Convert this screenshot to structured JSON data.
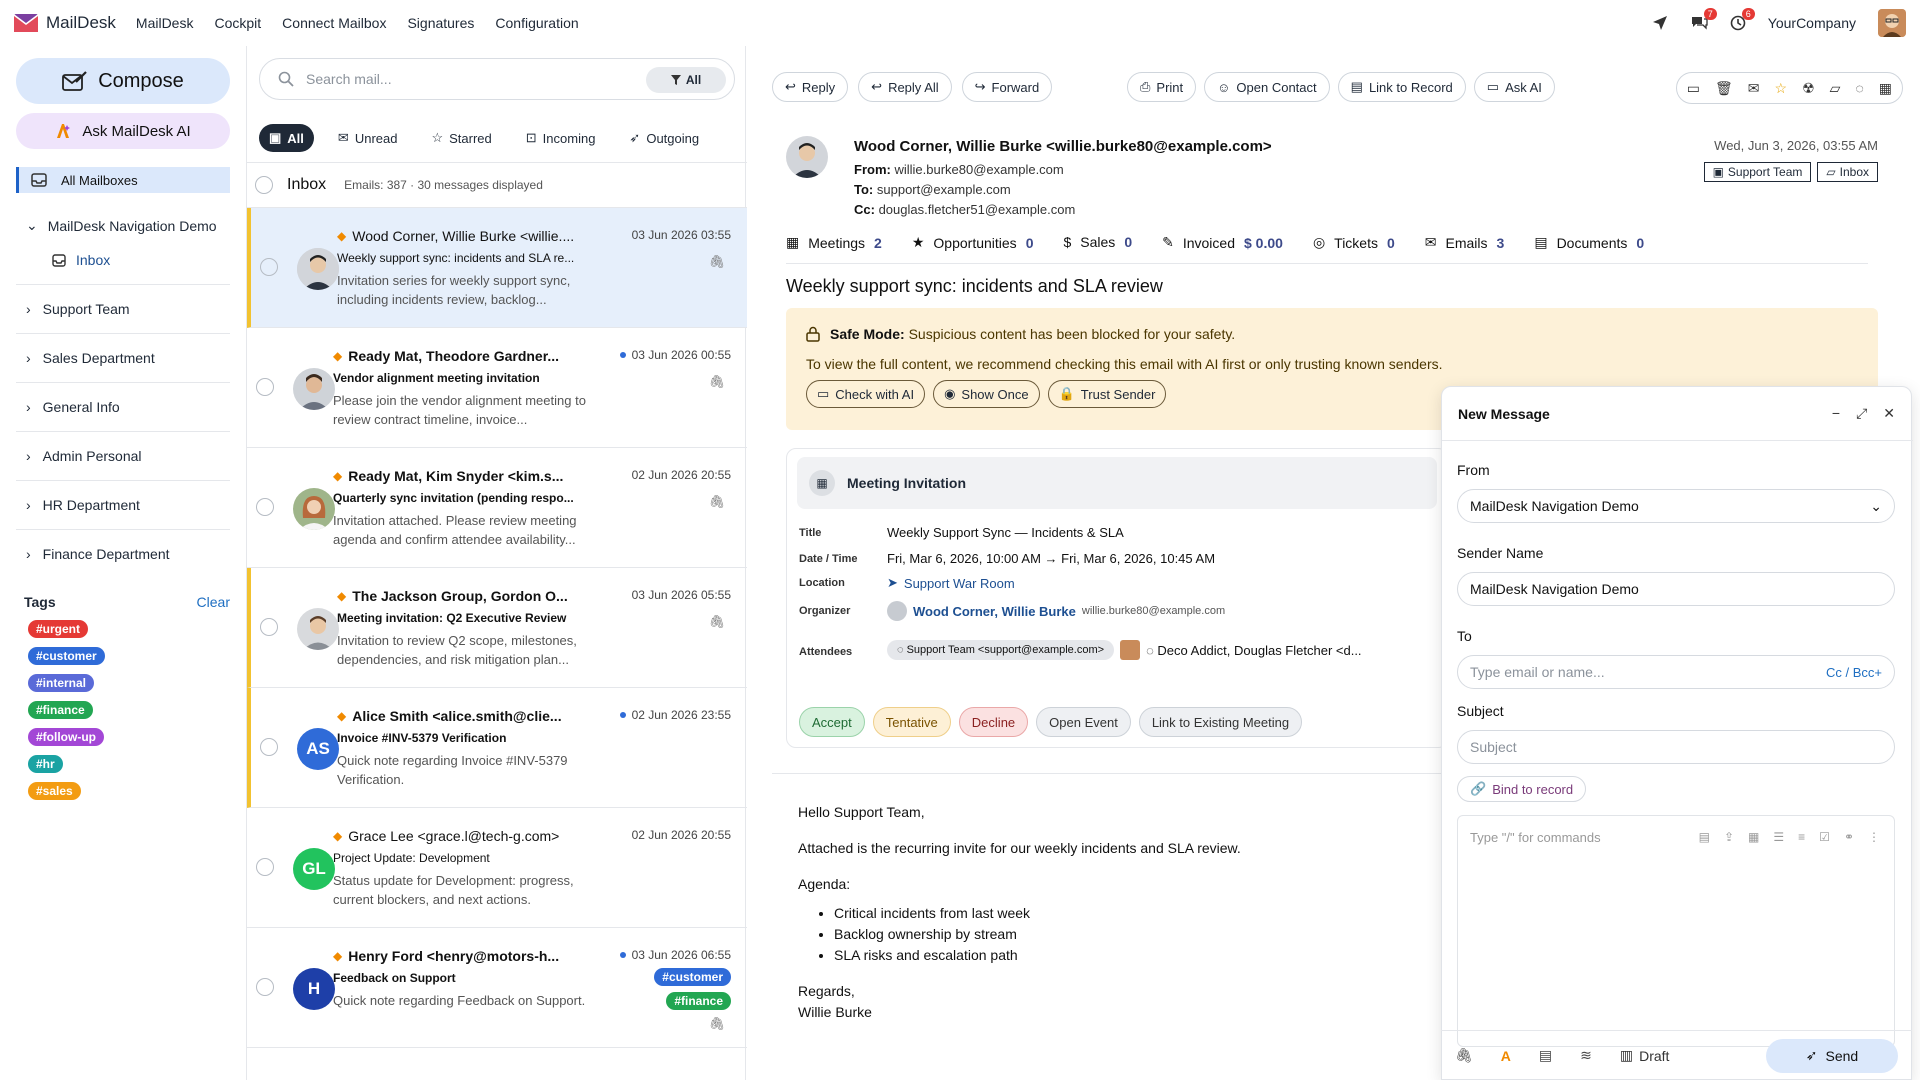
{
  "app": {
    "name": "MailDesk"
  },
  "topnav": [
    "MailDesk",
    "Cockpit",
    "Connect Mailbox",
    "Signatures",
    "Configuration"
  ],
  "topright": {
    "chat_badge": "7",
    "activity_badge": "6",
    "company": "YourCompany"
  },
  "sidebar": {
    "compose": "Compose",
    "ask_ai": "Ask MailDesk AI",
    "all_mailboxes": "All Mailboxes",
    "tree_head": "MailDesk Navigation Demo",
    "tree_inbox": "Inbox",
    "groups": [
      "Support Team",
      "Sales Department",
      "General Info",
      "Admin Personal",
      "HR Department",
      "Finance Department"
    ],
    "tags_title": "Tags",
    "tags_clear": "Clear",
    "tags": [
      {
        "label": "#urgent",
        "color": "#e53935"
      },
      {
        "label": "#customer",
        "color": "#2f6bd8"
      },
      {
        "label": "#internal",
        "color": "#5a6ad8"
      },
      {
        "label": "#finance",
        "color": "#22a652"
      },
      {
        "label": "#follow-up",
        "color": "#a347d6"
      },
      {
        "label": "#hr",
        "color": "#1aa3a3"
      },
      {
        "label": "#sales",
        "color": "#f39c12"
      }
    ]
  },
  "list": {
    "search_placeholder": "Search mail...",
    "search_filter": "All",
    "filters": [
      "All",
      "Unread",
      "Starred",
      "Incoming",
      "Outgoing"
    ],
    "folder": "Inbox",
    "count_text": "Emails: 387 · 30 messages displayed",
    "items": [
      {
        "sender": "Wood Corner, Willie Burke <willie....",
        "date": "03 Jun 2026 03:55",
        "subject": "Weekly support sync: incidents and SLA re...",
        "preview": "Invitation series for weekly support sync, including incidents review, backlog..."
      },
      {
        "sender": "Ready Mat, Theodore Gardner...",
        "date": "03 Jun 2026 00:55",
        "subject": "Vendor alignment meeting invitation",
        "preview": "Please join the vendor alignment meeting to review contract timeline, invoice..."
      },
      {
        "sender": "Ready Mat, Kim Snyder <kim.s...",
        "date": "02 Jun 2026 20:55",
        "subject": "Quarterly sync invitation (pending respo...",
        "preview": "Invitation attached. Please review meeting agenda and confirm attendee availability..."
      },
      {
        "sender": "The Jackson Group, Gordon O...",
        "date": "03 Jun 2026 05:55",
        "subject": "Meeting invitation: Q2 Executive Review",
        "preview": "Invitation to review Q2 scope, milestones, dependencies, and risk mitigation plan..."
      },
      {
        "sender": "Alice Smith <alice.smith@clie...",
        "date": "02 Jun 2026 23:55",
        "subject": "Invoice #INV-5379 Verification",
        "preview": "Quick note regarding Invoice #INV-5379 Verification.",
        "initials": "AS"
      },
      {
        "sender": "Grace Lee <grace.l@tech-g.com>",
        "date": "02 Jun 2026 20:55",
        "subject": "Project Update: Development",
        "preview": "Status update for Development: progress, current blockers, and next actions.",
        "initials": "GL"
      },
      {
        "sender": "Henry Ford <henry@motors-h...",
        "date": "03 Jun 2026 06:55",
        "subject": "Feedback on Support",
        "preview": "Quick note regarding Feedback on Support.",
        "initials": "H",
        "tag1": "#customer",
        "tag2": "#finance"
      }
    ]
  },
  "read": {
    "toolbar": [
      "Reply",
      "Reply All",
      "Forward"
    ],
    "toolbar2": [
      "Print",
      "Open Contact",
      "Link to Record",
      "Ask AI"
    ],
    "from_display": "Wood Corner, Willie Burke <willie.burke80@example.com>",
    "from_label": "From:",
    "from": "willie.burke80@example.com",
    "to_label": "To:",
    "to": "support@example.com",
    "cc_label": "Cc:",
    "cc": "douglas.fletcher51@example.com",
    "date": "Wed, Jun 3, 2026, 03:55 AM",
    "chip1": "Support Team",
    "chip2": "Inbox",
    "stats": [
      {
        "label": "Meetings",
        "value": "2"
      },
      {
        "label": "Opportunities",
        "value": "0"
      },
      {
        "label": "Sales",
        "value": "0"
      },
      {
        "label": "Invoiced",
        "value": "$ 0.00"
      },
      {
        "label": "Tickets",
        "value": "0"
      },
      {
        "label": "Emails",
        "value": "3"
      },
      {
        "label": "Documents",
        "value": "0"
      }
    ],
    "subject": "Weekly support sync: incidents and SLA review",
    "safe_title": "Safe Mode:",
    "safe_text": "Suspicious content has been blocked for your safety.",
    "safe_text2": "To view the full content, we recommend checking this email with AI first or only trusting known senders.",
    "safe_buttons": [
      "Check with AI",
      "Show Once",
      "Trust Sender"
    ],
    "meeting": {
      "title": "Meeting Invitation",
      "labels": [
        "Title",
        "Date / Time",
        "Location",
        "Organizer",
        "Attendees"
      ],
      "title_val": "Weekly Support Sync — Incidents & SLA",
      "date_val": "Fri, Mar 6, 2026, 10:00 AM → Fri, Mar 6, 2026, 10:45 AM",
      "location_val": "Support War Room",
      "organizer_name": "Wood Corner, Willie Burke",
      "organizer_email": "willie.burke80@example.com",
      "attendee1": "Support Team <support@example.com>",
      "attendee2": "Deco Addict, Douglas Fletcher <d...",
      "buttons": [
        "Accept",
        "Tentative",
        "Decline",
        "Open Event",
        "Link to Existing Meeting"
      ]
    },
    "body": {
      "greeting": "Hello Support Team,",
      "line1": "Attached is the recurring invite for our weekly incidents and SLA review.",
      "agenda": "Agenda:",
      "items": [
        "Critical incidents from last week",
        "Backlog ownership by stream",
        "SLA risks and escalation path"
      ],
      "regards": "Regards,",
      "name": "Willie Burke"
    }
  },
  "compose": {
    "title": "New Message",
    "from_label": "From",
    "from_value": "MailDesk Navigation Demo",
    "sender_label": "Sender Name",
    "sender_value": "MailDesk Navigation Demo",
    "to_label": "To",
    "to_placeholder": "Type email or name...",
    "ccbcc": "Cc / Bcc+",
    "subject_label": "Subject",
    "subject_placeholder": "Subject",
    "bind": "Bind to record",
    "editor_placeholder": "Type \"/\" for commands",
    "draft": "Draft",
    "send": "Send"
  }
}
